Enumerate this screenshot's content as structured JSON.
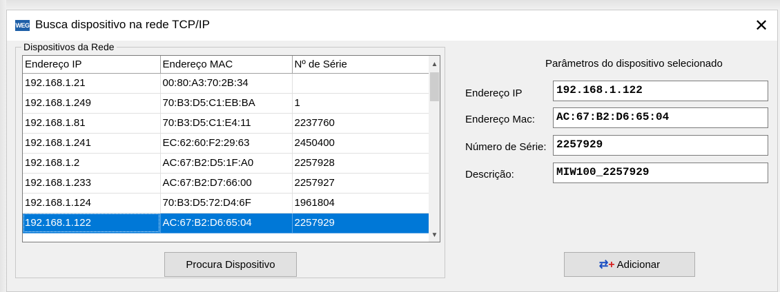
{
  "window": {
    "title": "Busca dispositivo na rede TCP/IP",
    "icon_text": "WEG",
    "close_glyph": "✕"
  },
  "group": {
    "legend": "Dispositivos da Rede"
  },
  "table": {
    "columns": [
      "Endereço IP",
      "Endereço MAC",
      "Nº de Série"
    ],
    "rows": [
      [
        "192.168.1.21",
        "00:80:A3:70:2B:34",
        ""
      ],
      [
        "192.168.1.249",
        "70:B3:D5:C1:EB:BA",
        "1"
      ],
      [
        "192.168.1.81",
        "70:B3:D5:C1:E4:11",
        "2237760"
      ],
      [
        "192.168.1.241",
        "EC:62:60:F2:29:63",
        "2450400"
      ],
      [
        "192.168.1.2",
        "AC:67:B2:D5:1F:A0",
        "2257928"
      ],
      [
        "192.168.1.233",
        "AC:67:B2:D7:66:00",
        "2257927"
      ],
      [
        "192.168.1.124",
        "70:B3:D5:72:D4:6F",
        "1961804"
      ],
      [
        "192.168.1.122",
        "AC:67:B2:D6:65:04",
        "2257929"
      ]
    ],
    "selected_row": 7
  },
  "buttons": {
    "search": "Procura Dispositivo",
    "add": "Adicionar"
  },
  "params": {
    "title": "Parâmetros do dispositivo selecionado",
    "ip_label": "Endereço IP",
    "ip_value": "192.168.1.122",
    "mac_label": "Endereço Mac:",
    "mac_value": "AC:67:B2:D6:65:04",
    "serial_label": "Número de Série:",
    "serial_value": "2257929",
    "desc_label": "Descrição:",
    "desc_value": "MIW100_2257929"
  },
  "colors": {
    "selection": "#0078d7",
    "icon_blue": "#1e5fa8"
  }
}
